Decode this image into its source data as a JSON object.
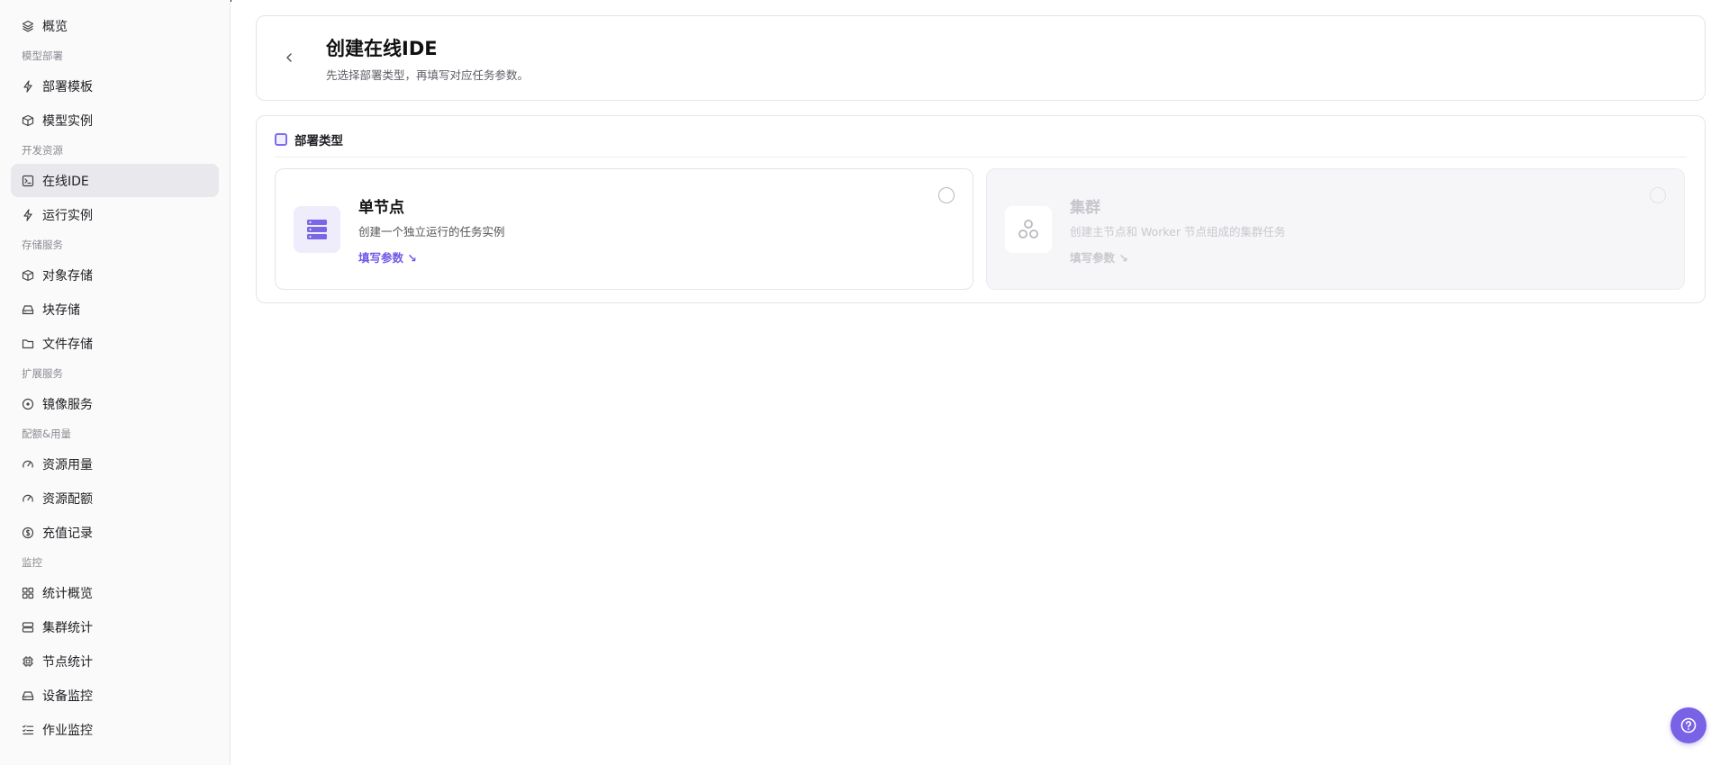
{
  "sidebar": {
    "items": [
      {
        "type": "item",
        "label": "概览",
        "icon": "layers-icon"
      },
      {
        "type": "section",
        "label": "模型部署"
      },
      {
        "type": "item",
        "label": "部署模板",
        "icon": "bolt-icon"
      },
      {
        "type": "item",
        "label": "模型实例",
        "icon": "cube-icon"
      },
      {
        "type": "section",
        "label": "开发资源"
      },
      {
        "type": "item",
        "label": "在线IDE",
        "icon": "terminal-icon",
        "active": true
      },
      {
        "type": "item",
        "label": "运行实例",
        "icon": "bolt-icon"
      },
      {
        "type": "section",
        "label": "存储服务"
      },
      {
        "type": "item",
        "label": "对象存储",
        "icon": "box-icon"
      },
      {
        "type": "item",
        "label": "块存储",
        "icon": "drive-icon"
      },
      {
        "type": "item",
        "label": "文件存储",
        "icon": "folder-icon"
      },
      {
        "type": "section",
        "label": "扩展服务"
      },
      {
        "type": "item",
        "label": "镜像服务",
        "icon": "disc-icon"
      },
      {
        "type": "section",
        "label": "配额&用量"
      },
      {
        "type": "item",
        "label": "资源用量",
        "icon": "gauge-icon"
      },
      {
        "type": "item",
        "label": "资源配额",
        "icon": "gauge-icon"
      },
      {
        "type": "item",
        "label": "充值记录",
        "icon": "coin-icon"
      },
      {
        "type": "section",
        "label": "监控"
      },
      {
        "type": "item",
        "label": "统计概览",
        "icon": "grid-icon"
      },
      {
        "type": "item",
        "label": "集群统计",
        "icon": "server-icon"
      },
      {
        "type": "item",
        "label": "节点统计",
        "icon": "chip-icon"
      },
      {
        "type": "item",
        "label": "设备监控",
        "icon": "drive-icon"
      },
      {
        "type": "item",
        "label": "作业监控",
        "icon": "checklist-icon"
      }
    ]
  },
  "header": {
    "title": "创建在线IDE",
    "subtitle": "先选择部署类型，再填写对应任务参数。"
  },
  "deploy": {
    "section_title": "部署类型",
    "options": {
      "single": {
        "title": "单节点",
        "desc": "创建一个独立运行的任务实例",
        "link": "填写参数 ↘",
        "icon": "server-stack-icon"
      },
      "cluster": {
        "title": "集群",
        "desc": "创建主节点和 Worker 节点组成的集群任务",
        "link": "填写参数 ↘",
        "icon": "cluster-icon",
        "disabled": true
      }
    }
  },
  "colors": {
    "accent": "#7a62e6",
    "active_bg": "#e9e9ed"
  },
  "help": {
    "icon": "help-icon"
  }
}
